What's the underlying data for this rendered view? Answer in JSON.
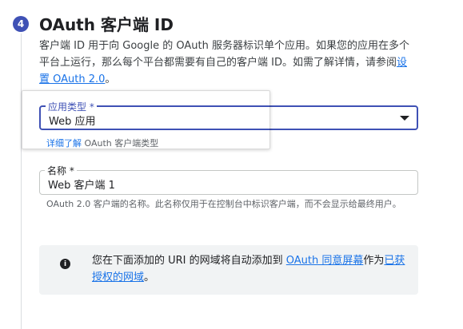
{
  "step": {
    "number": "4",
    "title": "OAuth 客户端 ID"
  },
  "description": {
    "text": "客户端 ID 用于向 Google 的 OAuth 服务器标识单个应用。如果您的应用在多个平台上运行，那么每个平台都需要有自己的客户端 ID。如需了解详情，请参阅",
    "link_text": "设置 OAuth 2.0",
    "suffix": "。"
  },
  "app_type": {
    "label": "应用类型 *",
    "value": "Web 应用",
    "help_link": "详细了解",
    "help_text": " OAuth 客户端类型"
  },
  "name": {
    "label": "名称 *",
    "value": "Web 客户端 1",
    "hint": "OAuth 2.0 客户端的名称。此名称仅用于在控制台中标识客户端，而不会显示给最终用户。"
  },
  "info": {
    "text_before": "您在下面添加的 URI 的网域将自动添加到 ",
    "link1": "OAuth 同意屏幕",
    "text_middle": "作为",
    "link2": "已获授权的网域",
    "suffix": "。"
  },
  "colors": {
    "accent": "#3f51b5",
    "link": "#1a73e8"
  }
}
